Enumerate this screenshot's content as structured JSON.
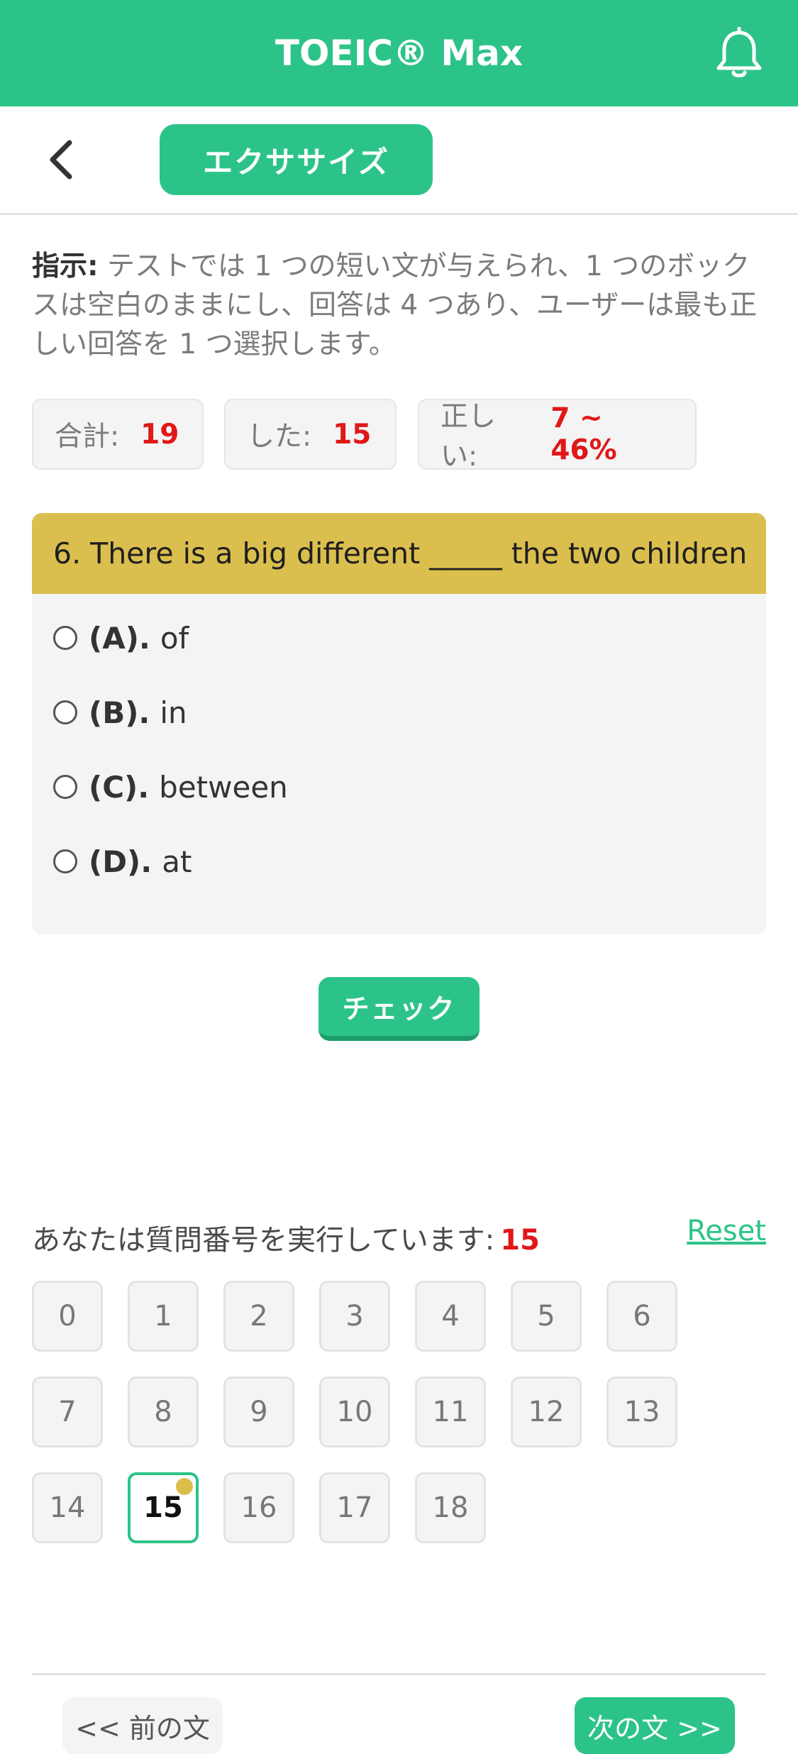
{
  "app": {
    "title": "TOEIC® Max"
  },
  "header": {
    "tab_label": "エクササイズ"
  },
  "instruction": {
    "label": "指示:",
    "text": " テストでは 1 つの短い文が与えられ、1 つのボックスは空白のままにし、回答は 4 つあり、ユーザーは最も正しい回答を 1 つ選択します。"
  },
  "stats": {
    "total_label": "合計:",
    "total_value": "19",
    "done_label": "した:",
    "done_value": "15",
    "correct_label": "正しい:",
    "correct_value": "7 ~ 46%"
  },
  "question": {
    "text": "6. There is a big different _____ the two children",
    "options": [
      {
        "letter": "(A).",
        "text": "of"
      },
      {
        "letter": "(B).",
        "text": "in"
      },
      {
        "letter": "(C).",
        "text": "between"
      },
      {
        "letter": "(D).",
        "text": "at"
      }
    ],
    "check_label": "チェック"
  },
  "progress": {
    "text": "あなたは質問番号を実行しています:",
    "current": "15",
    "reset_label": "Reset"
  },
  "numbers": [
    "0",
    "1",
    "2",
    "3",
    "4",
    "5",
    "6",
    "7",
    "8",
    "9",
    "10",
    "11",
    "12",
    "13",
    "14",
    "15",
    "16",
    "17",
    "18"
  ],
  "nav": {
    "prev_label": "<< 前の文",
    "next_label": "次の文 >>"
  },
  "colors": {
    "brand": "#2cc389",
    "question_header": "#dbbf4e",
    "accent_red": "#e01818"
  },
  "icons": {
    "bell": "bell-icon",
    "back": "chevron-left-icon"
  }
}
